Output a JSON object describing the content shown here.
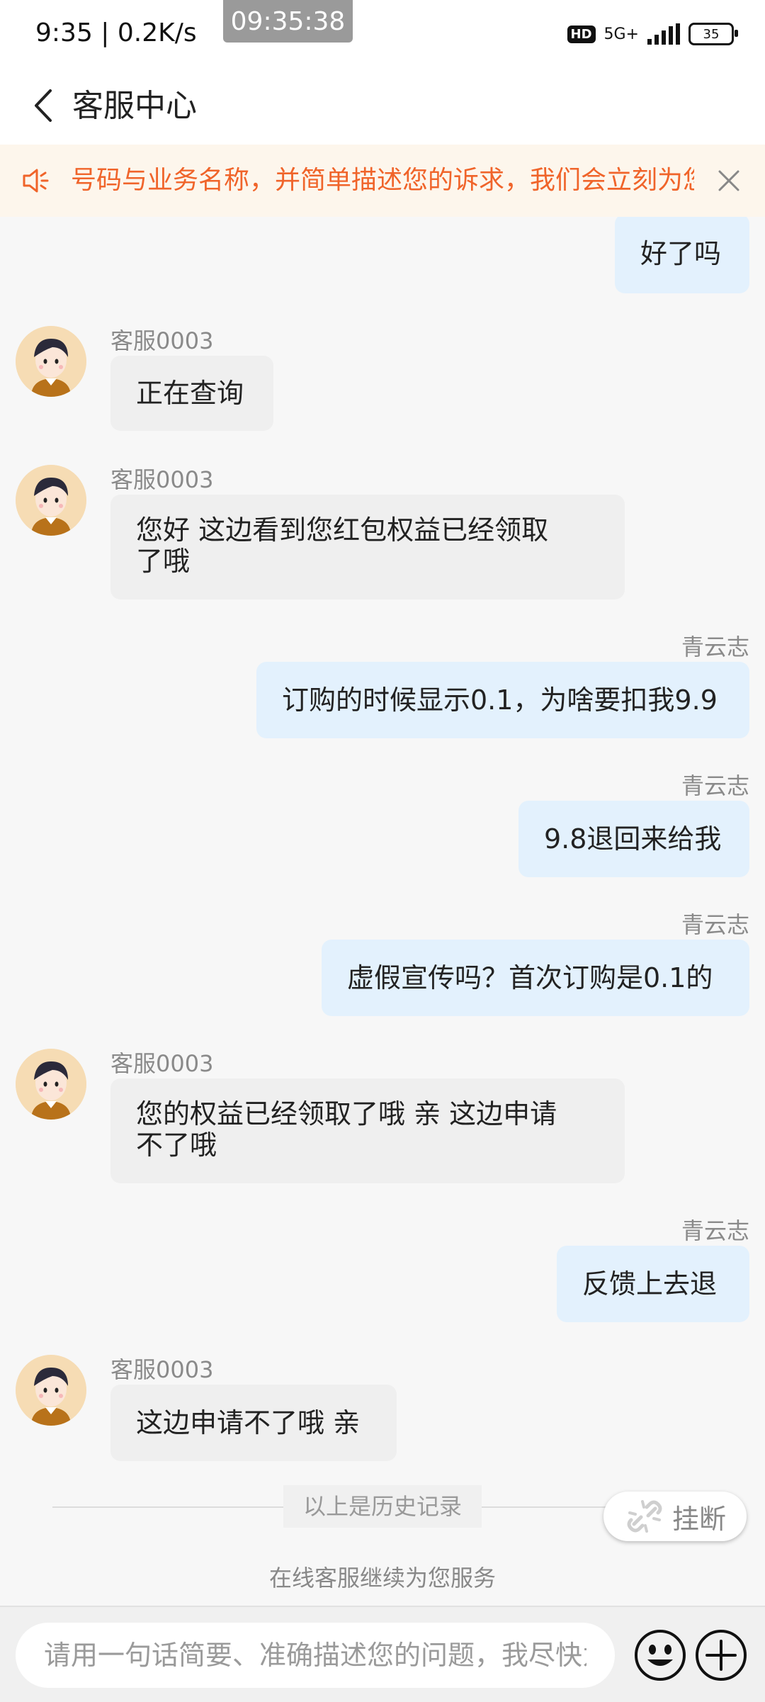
{
  "status_bar": {
    "time_speed": "9:35 | 0.2K/s",
    "clock_overlay": "09:35:38",
    "hd": "HD",
    "network": "5G+",
    "battery": "35"
  },
  "header": {
    "title": "客服中心"
  },
  "notice": {
    "text": "号码与业务名称，并简单描述您的诉求，我们会立刻为您处理"
  },
  "messages": [
    {
      "role": "user",
      "sender": "",
      "text": "好了吗"
    },
    {
      "role": "agent",
      "sender": "客服0003",
      "text": "正在查询"
    },
    {
      "role": "agent",
      "sender": "客服0003",
      "text_lines": [
        "您好 这边看到您红包权益已经领取",
        "了哦"
      ]
    },
    {
      "role": "user",
      "sender": "青云志",
      "text": "订购的时候显示0.1，为啥要扣我9.9"
    },
    {
      "role": "user",
      "sender": "青云志",
      "text": "9.8退回来给我"
    },
    {
      "role": "user",
      "sender": "青云志",
      "text": "虚假宣传吗？首次订购是0.1的"
    },
    {
      "role": "agent",
      "sender": "客服0003",
      "text_lines": [
        "您的权益已经领取了哦 亲 这边申请",
        "不了哦"
      ]
    },
    {
      "role": "user",
      "sender": "青云志",
      "text": "反馈上去退"
    },
    {
      "role": "agent",
      "sender": "客服0003",
      "text": "这边申请不了哦 亲"
    }
  ],
  "history_divider": "以上是历史记录",
  "hangup_label": "挂断",
  "continue_text": "在线客服继续为您服务",
  "input": {
    "placeholder": "请用一句话简要、准确描述您的问题，我尽快为您解答"
  },
  "colors": {
    "user_bubble": "#e3f1fd",
    "agent_bubble": "#efefef",
    "notice_text": "#f0642a",
    "notice_bg": "#fdf6ec"
  }
}
